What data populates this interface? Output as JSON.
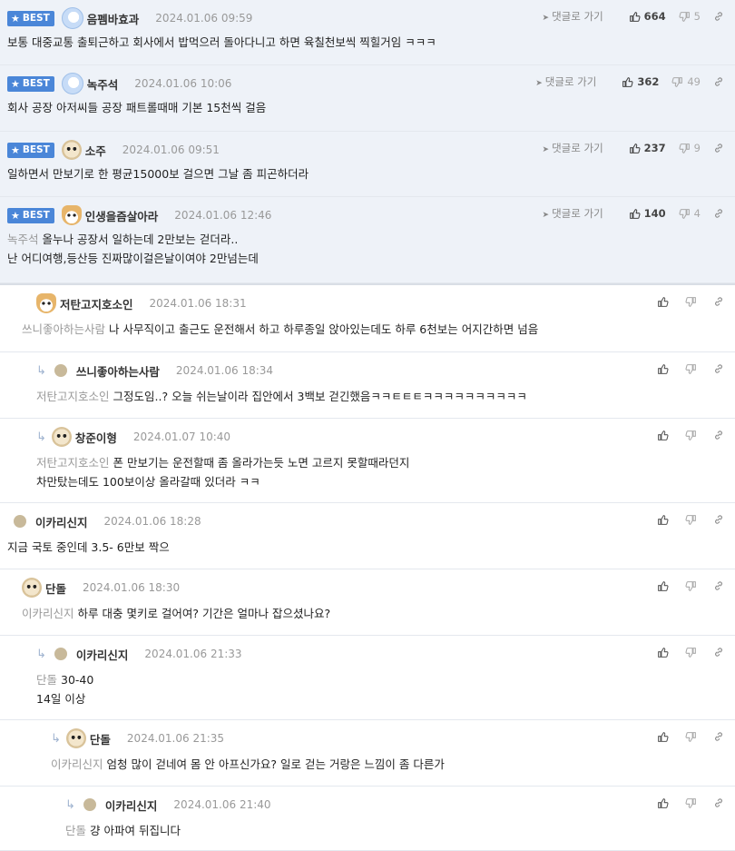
{
  "labels": {
    "best": "BEST",
    "goto": "댓글로 가기"
  },
  "best": [
    {
      "nick": "음펨바효과",
      "date": "2024.01.06 09:59",
      "up": "664",
      "down": "5",
      "avatar": "blue",
      "text": "보통 대중교통 출퇴근하고 회사에서 밥먹으러 돌아다니고 하면 육칠천보씩 찍힐거임 ㅋㅋㅋ"
    },
    {
      "nick": "녹주석",
      "date": "2024.01.06 10:06",
      "up": "362",
      "down": "49",
      "avatar": "blue",
      "text": "회사 공장 아저씨들 공장 패트롤때매 기본 15천씩 걸음"
    },
    {
      "nick": "소주",
      "date": "2024.01.06 09:51",
      "up": "237",
      "down": "9",
      "avatar": "dog",
      "text": "일하면서 만보기로 한 평균15000보 걸으면 그날 좀 피곤하더라"
    },
    {
      "nick": "인생을즘살아라",
      "date": "2024.01.06 12:46",
      "up": "140",
      "down": "4",
      "avatar": "fox",
      "mention": "녹주석",
      "text": "올누나 공장서 일하는데 2만보는 걷더라..",
      "text2": "난 어디여행,등산등 진짜많이걸은날이여야 2만넘는데"
    }
  ],
  "comments": [
    {
      "nick": "저탄고지호소인",
      "date": "2024.01.06 18:31",
      "avatar": "fox",
      "mention": "쓰니좋아하는사람",
      "text": "나 사무직이고 출근도 운전해서 하고 하루종일 앉아있는데도 하루 6천보는 어지간하면 넘음"
    },
    {
      "nick": "쓰니좋아하는사람",
      "date": "2024.01.06 18:34",
      "avatar": "dot",
      "mention": "저탄고지호소인",
      "text": "그정도임..? 오늘 쉬는날이라 집안에서 3백보 걷긴했음ㅋㅋㅌㅌㅌㅋㅋㅋㅋㅋㅋㅋㅋㅋㅋ"
    },
    {
      "nick": "창준이형",
      "date": "2024.01.07 10:40",
      "avatar": "dog",
      "mention": "저탄고지호소인",
      "text": "폰 만보기는 운전할때 좀 올라가는듯 노면 고르지 못할때라던지",
      "text2": "차만탔는데도 100보이상 올라갈때 있더라 ㅋㅋ"
    },
    {
      "nick": "이카리신지",
      "date": "2024.01.06 18:28",
      "avatar": "dot",
      "text": "지금 국토 중인데 3.5- 6만보 짝으"
    },
    {
      "nick": "단돌",
      "date": "2024.01.06 18:30",
      "avatar": "dog",
      "mention": "이카리신지",
      "text": "하루 대충 몇키로 걸어여? 기간은 얼마나 잡으셨나요?"
    },
    {
      "nick": "이카리신지",
      "date": "2024.01.06 21:33",
      "avatar": "dot",
      "mention": "단돌",
      "text": "30-40",
      "text2": "14일 이상"
    },
    {
      "nick": "단돌",
      "date": "2024.01.06 21:35",
      "avatar": "dog",
      "mention": "이카리신지",
      "text": "엄청 많이 걷네여 몸 안 아프신가요? 일로 걷는 거랑은 느낌이 좀 다른가"
    },
    {
      "nick": "이카리신지",
      "date": "2024.01.06 21:40",
      "avatar": "dot",
      "mention": "단돌",
      "text": "걍 아파여 뒤집니다"
    }
  ]
}
